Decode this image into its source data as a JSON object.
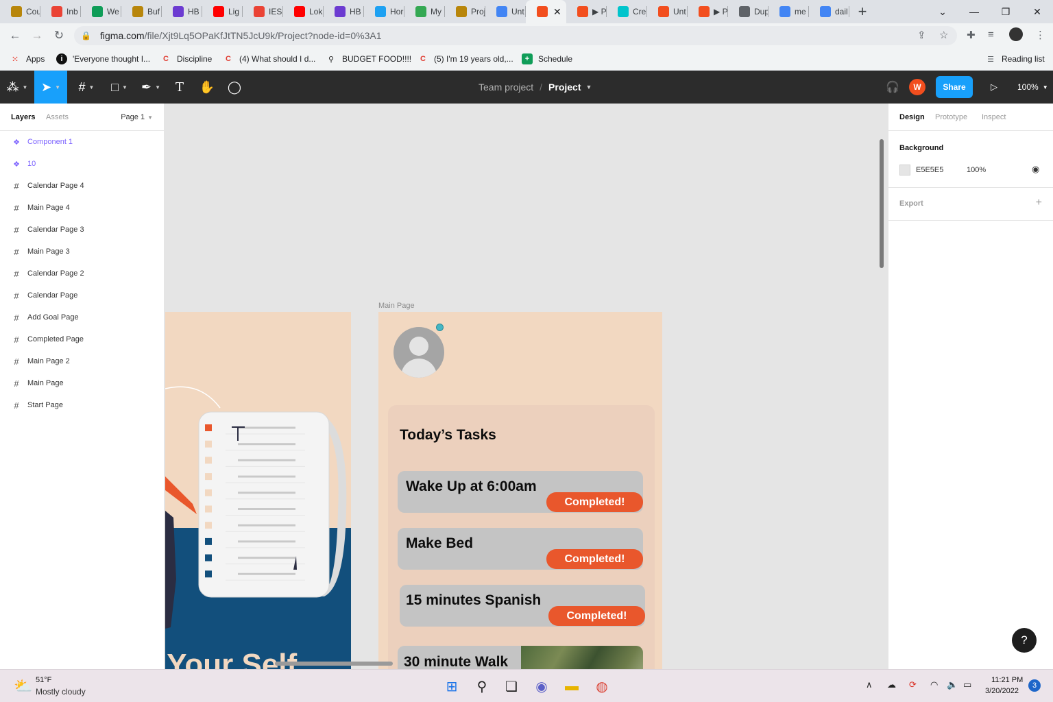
{
  "browser": {
    "tabs": [
      {
        "label": "Cou",
        "icon": "buffalo-icon",
        "color": "#b8860b"
      },
      {
        "label": "Inb",
        "icon": "gmail-icon",
        "color": "#ea4335"
      },
      {
        "label": "We",
        "icon": "sheets-icon",
        "color": "#0f9d58"
      },
      {
        "label": "Buf",
        "icon": "buffalo-icon",
        "color": "#b8860b"
      },
      {
        "label": "HB",
        "icon": "m-icon",
        "color": "#6c3bd1"
      },
      {
        "label": "Lig",
        "icon": "youtube-icon",
        "color": "#ff0000"
      },
      {
        "label": "IES",
        "icon": "gmail-icon",
        "color": "#ea4335"
      },
      {
        "label": "Lok",
        "icon": "youtube-icon",
        "color": "#ff0000"
      },
      {
        "label": "HB",
        "icon": "m-icon",
        "color": "#6c3bd1"
      },
      {
        "label": "Hor",
        "icon": "twitter-icon",
        "color": "#1da1f2"
      },
      {
        "label": "My",
        "icon": "drive-icon",
        "color": "#34a853"
      },
      {
        "label": "Proj",
        "icon": "buffalo-icon",
        "color": "#b8860b"
      },
      {
        "label": "Unt",
        "icon": "docs-icon",
        "color": "#4285f4"
      },
      {
        "label": "",
        "icon": "figma-icon",
        "color": "#f24e1e",
        "active": true
      },
      {
        "label": "▶ P",
        "icon": "figma-icon",
        "color": "#f24e1e"
      },
      {
        "label": "Cre",
        "icon": "canva-icon",
        "color": "#00c4cc"
      },
      {
        "label": "Unt",
        "icon": "figma-icon",
        "color": "#f24e1e"
      },
      {
        "label": "▶ P",
        "icon": "figma-icon",
        "color": "#f24e1e"
      },
      {
        "label": "Dup",
        "icon": "globe-icon",
        "color": "#5f6368"
      },
      {
        "label": "me",
        "icon": "google-icon",
        "color": "#4285f4"
      },
      {
        "label": "dail",
        "icon": "google-icon",
        "color": "#4285f4"
      }
    ],
    "new_tab": "+",
    "url_host": "figma.com",
    "url_path": "/file/Xjt9Lq5OPaKfJtTN5JcU9k/Project?node-id=0%3A1",
    "bookmarks": [
      {
        "label": "Apps",
        "icon": "apps-grid-icon"
      },
      {
        "label": "'Everyone thought I...",
        "icon": "info-icon"
      },
      {
        "label": "Discipline",
        "icon": "c-icon"
      },
      {
        "label": "(4) What should I d...",
        "icon": "c-icon"
      },
      {
        "label": "BUDGET FOOD!!!!",
        "icon": "magnifier-icon"
      },
      {
        "label": "(5) I'm 19 years old,...",
        "icon": "c-icon"
      },
      {
        "label": "Schedule",
        "icon": "sheets-icon"
      }
    ],
    "reading_list": "Reading list"
  },
  "figma": {
    "team": "Team project",
    "project": "Project",
    "separator": "/",
    "avatar_initial": "W",
    "share_label": "Share",
    "zoom": "100%",
    "left_panel": {
      "tab_layers": "Layers",
      "tab_assets": "Assets",
      "page_selector": "Page 1",
      "layers": [
        {
          "label": "Component 1",
          "type": "component"
        },
        {
          "label": "10",
          "type": "component"
        },
        {
          "label": "Calendar Page 4",
          "type": "frame"
        },
        {
          "label": "Main Page 4",
          "type": "frame"
        },
        {
          "label": "Calendar Page 3",
          "type": "frame"
        },
        {
          "label": "Main Page 3",
          "type": "frame"
        },
        {
          "label": "Calendar Page 2",
          "type": "frame"
        },
        {
          "label": "Calendar Page",
          "type": "frame"
        },
        {
          "label": "Add Goal Page",
          "type": "frame"
        },
        {
          "label": "Completed Page",
          "type": "frame"
        },
        {
          "label": "Main Page 2",
          "type": "frame"
        },
        {
          "label": "Main Page",
          "type": "frame"
        },
        {
          "label": "Start Page",
          "type": "frame"
        }
      ]
    },
    "right_panel": {
      "tab_design": "Design",
      "tab_prototype": "Prototype",
      "tab_inspect": "Inspect",
      "background_title": "Background",
      "background_hex": "E5E5E5",
      "background_opacity": "100%",
      "export_title": "Export"
    },
    "canvas": {
      "frame_label": "Main Page",
      "start_page_heading": "n Your Self",
      "tasks_title": "Today’s Tasks",
      "tasks": [
        {
          "name": "Wake Up at 6:00am",
          "status": "Completed!"
        },
        {
          "name": "Make Bed",
          "status": "Completed!"
        },
        {
          "name": "15 minutes Spanish",
          "status": "Completed!"
        },
        {
          "name": "30 minute Walk",
          "status": ""
        }
      ],
      "colors": {
        "frame_bg": "#f2d8c1",
        "card_bg": "#ecd0bd",
        "task_bg": "#c4c4c4",
        "button": "#e9572c",
        "blue": "#124f7c"
      }
    },
    "help": "?"
  },
  "taskbar": {
    "temperature": "51°F",
    "weather": "Mostly cloudy",
    "time": "11:21 PM",
    "date": "3/20/2022",
    "notifications": "3"
  }
}
